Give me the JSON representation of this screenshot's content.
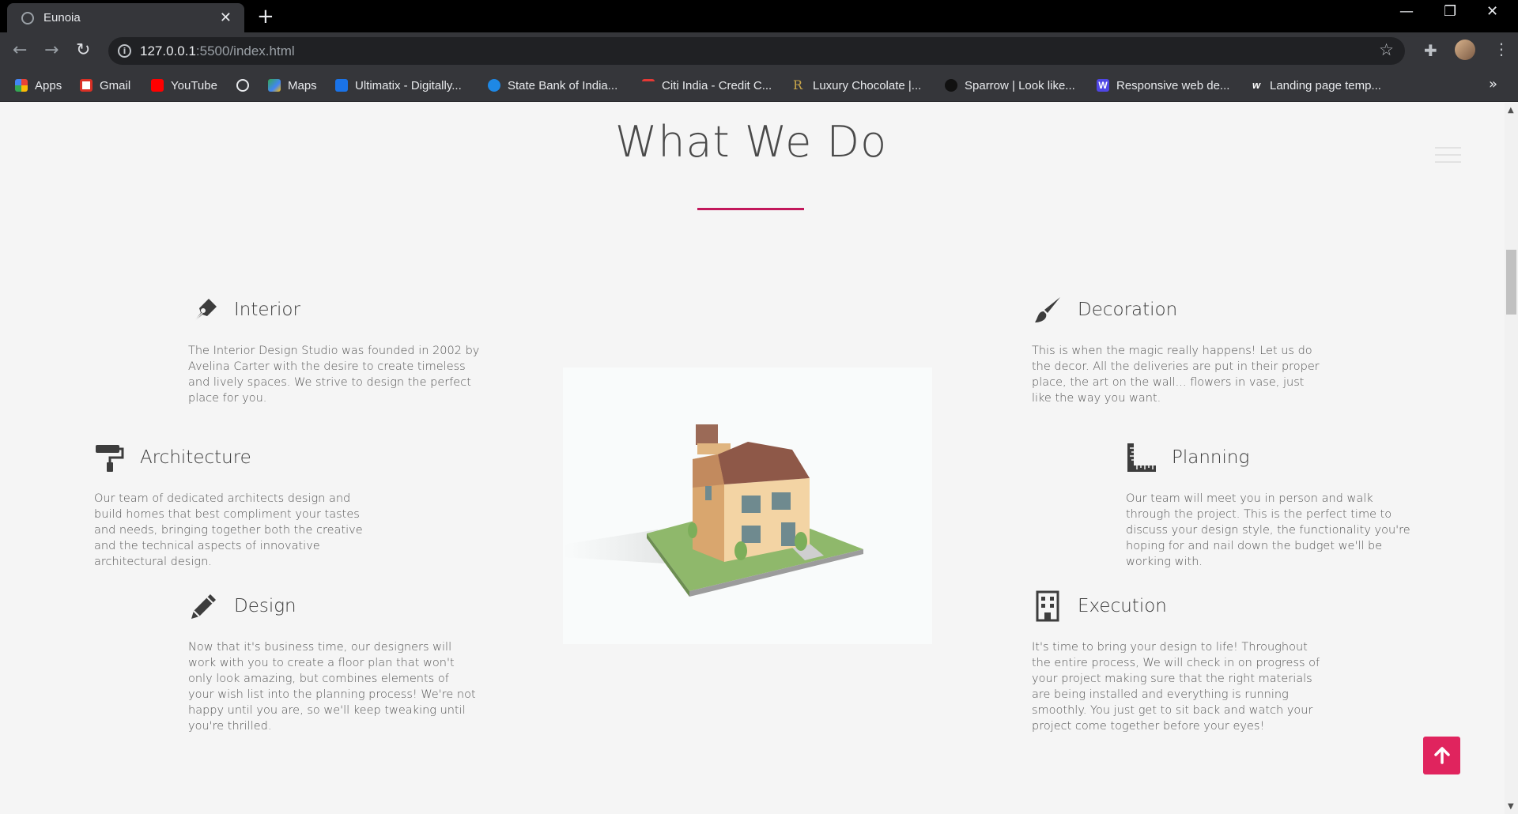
{
  "browser": {
    "tab_title": "Eunoia",
    "url_host": "127.0.0.1",
    "url_rest": ":5500/index.html",
    "bookmarks": [
      {
        "label": "Apps",
        "color": "#ea4335"
      },
      {
        "label": "Gmail",
        "color": "#d93025"
      },
      {
        "label": "YouTube",
        "color": "#ff0000"
      },
      {
        "label": "",
        "color": "#9aa0a6"
      },
      {
        "label": "Maps",
        "color": "#34a853"
      },
      {
        "label": "Ultimatix - Digitally...",
        "color": "#1a73e8"
      },
      {
        "label": "State Bank of India...",
        "color": "#1e88e5"
      },
      {
        "label": "Citi India - Credit C...",
        "color": "#0d47a1"
      },
      {
        "label": "Luxury Chocolate |...",
        "color": "#c9a64a"
      },
      {
        "label": "Sparrow | Look like...",
        "color": "#111111"
      },
      {
        "label": "Responsive web de...",
        "color": "#4f46e5"
      },
      {
        "label": "Landing page temp...",
        "color": "#ffffff"
      }
    ],
    "more_label": "»"
  },
  "section": {
    "title": "What We Do"
  },
  "services": {
    "interior": {
      "title": "Interior",
      "text": "The Interior Design Studio was founded in 2002 by Avelina Carter with the desire to create timeless and lively spaces. We strive to design the perfect place for you.",
      "icon": "pen-nib-icon"
    },
    "architecture": {
      "title": "Architecture",
      "text": "Our team of dedicated architects design and build homes that best compliment your tastes and needs, bringing together both the creative and the technical aspects of innovative architectural design.",
      "icon": "paint-roller-icon"
    },
    "design": {
      "title": "Design",
      "text": "Now that it's business time, our designers will work with you to create a floor plan that won't only look amazing, but combines elements of your wish list into the planning process! We're not happy until you are, so we'll keep tweaking until you're thrilled.",
      "icon": "pencil-icon"
    },
    "decoration": {
      "title": "Decoration",
      "text": "This is when the magic really happens! Let us do the decor. All the deliveries are put in their proper place, the art on the wall... flowers in vase, just like the way you want.",
      "icon": "paint-brush-icon"
    },
    "planning": {
      "title": "Planning",
      "text": "Our team will meet you in person and walk through the project. This is the perfect time to discuss your design style, the functionality you're hoping for and nail down the budget we'll be working with.",
      "icon": "ruler-icon"
    },
    "execution": {
      "title": "Execution",
      "text": "It's time to bring your design to life! Throughout the entire process, We will check in on progress of your project making sure that the right materials are being installed and everything is running smoothly. You just get to sit back and watch your project come together before your eyes!",
      "icon": "building-icon"
    }
  },
  "colors": {
    "accent": "#c2185b",
    "top_button": "#e0245e"
  }
}
